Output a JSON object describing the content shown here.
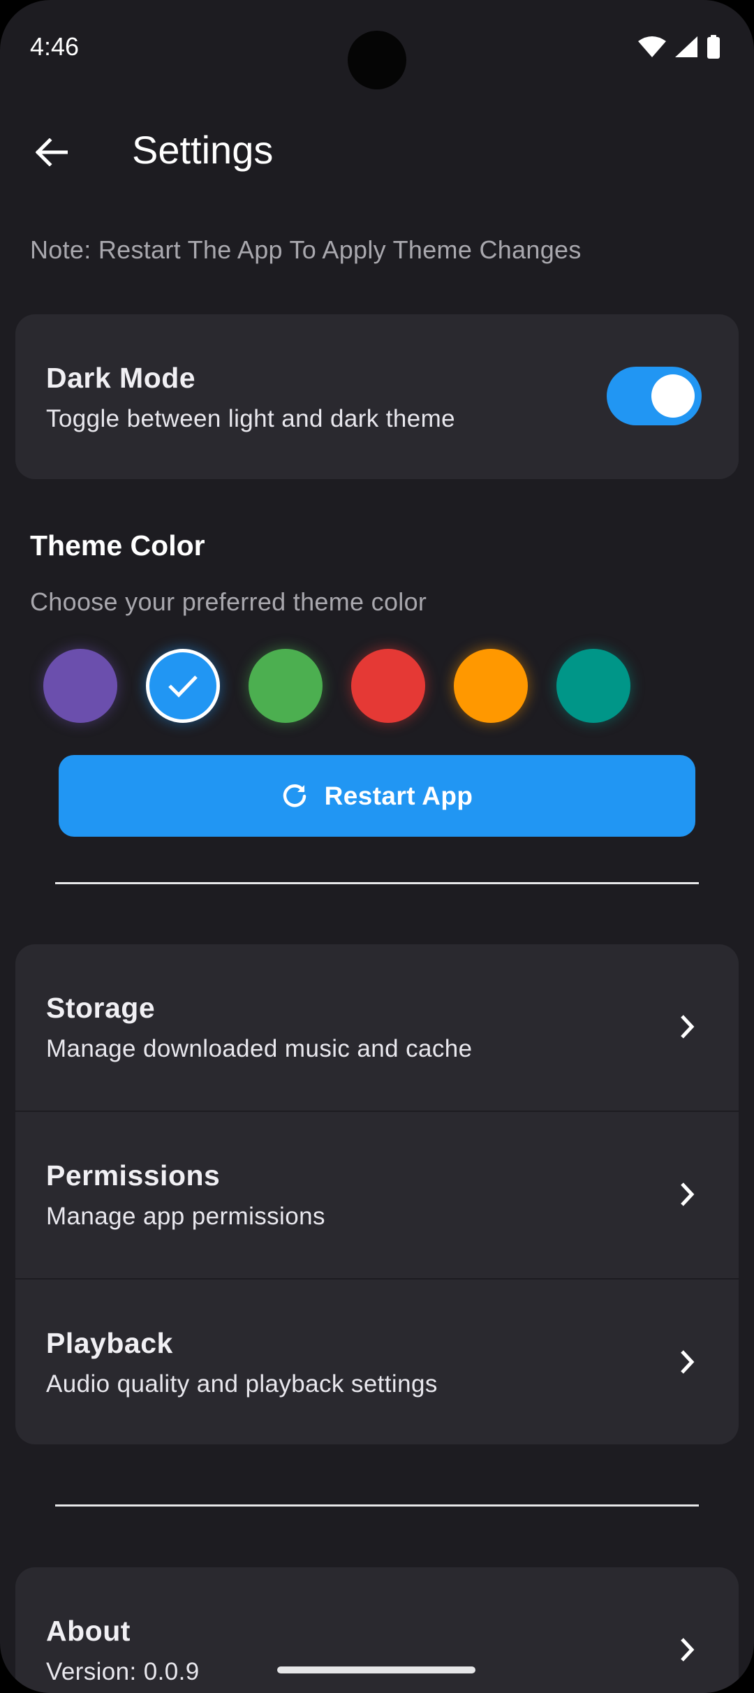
{
  "status_bar": {
    "time": "4:46",
    "icons": [
      "wifi-icon",
      "signal-icon",
      "battery-icon"
    ]
  },
  "app_bar": {
    "back_icon": "arrow-back-icon",
    "title": "Settings"
  },
  "note": "Note: Restart The App To Apply Theme Changes",
  "dark_mode": {
    "title": "Dark Mode",
    "subtitle": "Toggle between light and dark theme",
    "enabled": true
  },
  "theme_color": {
    "title": "Theme Color",
    "subtitle": "Choose your preferred theme color",
    "swatches": [
      {
        "color": "#6b4fad",
        "selected": false
      },
      {
        "color": "#2196f3",
        "selected": true
      },
      {
        "color": "#4caf50",
        "selected": false
      },
      {
        "color": "#e53935",
        "selected": false
      },
      {
        "color": "#ff9800",
        "selected": false
      },
      {
        "color": "#009688",
        "selected": false
      }
    ]
  },
  "restart_button": {
    "icon": "refresh-icon",
    "label": "Restart App"
  },
  "settings_list": [
    {
      "title": "Storage",
      "subtitle": "Manage downloaded music and cache"
    },
    {
      "title": "Permissions",
      "subtitle": "Manage app permissions"
    },
    {
      "title": "Playback",
      "subtitle": "Audio quality and playback settings"
    }
  ],
  "about": {
    "title": "About",
    "subtitle": "Version: 0.0.9"
  },
  "colors": {
    "background": "#1d1c21",
    "card": "#2a292f",
    "accent": "#2196f3"
  }
}
